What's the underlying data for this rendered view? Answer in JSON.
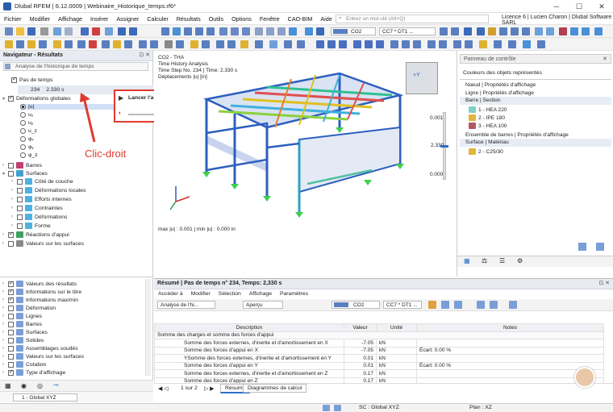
{
  "app": {
    "title": "Dlubal RFEM | 6.12.0009 | Webinaire_Historique_temps.rf6*",
    "win_min": "─",
    "win_max": "☐",
    "win_close": "✕"
  },
  "menu": [
    "Fichier",
    "Modifier",
    "Affichage",
    "Insérer",
    "Assigner",
    "Calculer",
    "Résultats",
    "Outils",
    "Options",
    "Fenêtre",
    "CAO-BIM",
    "Aide"
  ],
  "search_placeholder": "Entrez un mot-clé (Alt+Q)",
  "licence": "Licence 6 | Lucien Charon | Dlubal Software SARL",
  "toolbar": {
    "loadcase": "CO2",
    "combo": "CC7 * DT1 ...",
    "aspect": "Aperçu",
    "coord": "1 - Global XYZ"
  },
  "navigator": {
    "title": "Navigateur - Résultats",
    "dropdown": "Analyse de l'historique de temps",
    "step_label": "Pas de temps",
    "step_no": "234",
    "step_time": "2.330 s",
    "items": [
      {
        "label": "Déformations globales",
        "level": 0,
        "check": "on",
        "kind": "folder"
      },
      {
        "label": "|u|",
        "level": 1,
        "radio": "on"
      },
      {
        "label": "uₓ",
        "level": 1,
        "radio": "off"
      },
      {
        "label": "uᵧ",
        "level": 1,
        "radio": "off"
      },
      {
        "label": "u_z",
        "level": 1,
        "radio": "off"
      },
      {
        "label": "φₓ",
        "level": 1,
        "radio": "off"
      },
      {
        "label": "φᵧ",
        "level": 1,
        "radio": "off"
      },
      {
        "label": "φ_z",
        "level": 1,
        "radio": "off"
      },
      {
        "label": "Barres",
        "level": 0,
        "check": "off",
        "kind": "bar"
      },
      {
        "label": "Surfaces",
        "level": 0,
        "check": "off",
        "kind": "surf"
      },
      {
        "label": "Côté de couche",
        "level": 1,
        "check": "off"
      },
      {
        "label": "Déformations locales",
        "level": 1,
        "check": "off"
      },
      {
        "label": "Efforts internes",
        "level": 1,
        "check": "off"
      },
      {
        "label": "Contraintes",
        "level": 1,
        "check": "off"
      },
      {
        "label": "Déformations",
        "level": 1,
        "check": "off"
      },
      {
        "label": "Forme",
        "level": 1,
        "check": "off"
      },
      {
        "label": "Réactions d'appui",
        "level": 0,
        "check": "on"
      },
      {
        "label": "Valeurs sur les surfaces",
        "level": 0,
        "check": "off"
      }
    ],
    "lower": [
      "Valeurs des résultats",
      "Informations sur le titre",
      "Informations max/min",
      "Déformation",
      "Lignes",
      "Barres",
      "Surfaces",
      "Solides",
      "Assemblages soudés",
      "Valeurs sur les surfaces",
      "Cotation",
      "Type d'affichage"
    ],
    "lower_checks": [
      true,
      true,
      true,
      false,
      false,
      false,
      false,
      false,
      false,
      false,
      false,
      true
    ]
  },
  "popup": {
    "label": "Lancer l'animation"
  },
  "annotation": {
    "text": "Clic-droit",
    "color": "#e03a30"
  },
  "view": {
    "l1": "CO2 - THA",
    "l2": "Time History Analysis",
    "l3": "Time Step No. 234 | Time: 2.330 s",
    "l4": "Déplacements |u| [in]",
    "maxmin": "max |u| : 0.001 | min |u| : 0.000 in",
    "scale_top": "0.001",
    "scale_mid": "2.330",
    "scale_bot": "0.000"
  },
  "control": {
    "title": "Panneau de contrôle",
    "subtitle": "Couleurs des objets représentés",
    "g1": "Nœud | Propriétés d'affichage",
    "g2": "Ligne | Propriétés d'affichage",
    "g3": "Barre | Section",
    "sections": [
      {
        "label": "1 - HEA 220",
        "color": "#7fd0c8"
      },
      {
        "label": "2 - IPE 180",
        "color": "#e3b33a"
      },
      {
        "label": "3 - HEA 100",
        "color": "#b05a66"
      }
    ],
    "g4": "Ensemble de barres | Propriétés d'affichage",
    "g5": "Surface | Matériau",
    "materials": [
      {
        "label": "2 - C25/30",
        "color": "#e3b33a"
      }
    ]
  },
  "results": {
    "title": "Résumé | Pas de temps n° 234, Temps: 2,330 s",
    "menu": [
      "Accéder à",
      "Modifier",
      "Sélection",
      "Affichage",
      "Paramètres"
    ],
    "analysis": "Analyse de l'hi...",
    "headers": [
      "Description",
      "Valeur",
      "Unité",
      "Notes"
    ],
    "group": "Somme des charges et somme des forces d'appui",
    "rows": [
      {
        "d": "Somme des forces externes, d'inertie et d'amortissement en X",
        "v": "-7.05",
        "u": "kN",
        "n": ""
      },
      {
        "d": "Somme des forces d'appui en X",
        "v": "-7.05",
        "u": "kN",
        "n": "Écart: 0.00 %"
      },
      {
        "d": "YSomme des forces externes, d'inertie et d'amortissement en Y",
        "v": "0.01",
        "u": "kN",
        "n": ""
      },
      {
        "d": "Somme des forces d'appui en Y",
        "v": "0.01",
        "u": "kN",
        "n": "Écart: 0.00 %"
      },
      {
        "d": "Somme des forces externes, d'inertie et d'amortissement en Z",
        "v": "0.17",
        "u": "kN",
        "n": ""
      },
      {
        "d": "Somme des forces d'appui en Z",
        "v": "0.17",
        "u": "kN",
        "n": ""
      }
    ],
    "pager": "1 sur 2",
    "tabs": [
      "Résumé",
      "Diagrammes de calcul"
    ]
  },
  "status": {
    "sc": "SC : Global XYZ",
    "plan": "Plan : XZ"
  }
}
